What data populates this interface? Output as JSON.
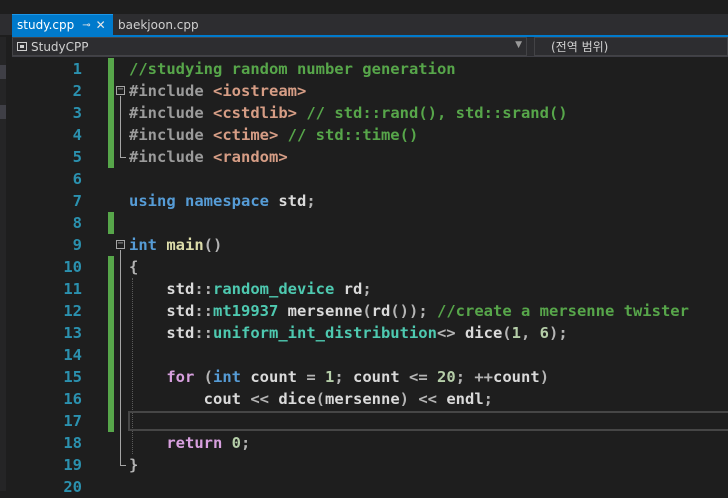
{
  "tabs": [
    {
      "label": "study.cpp",
      "active": true,
      "pin_icon": "pin-icon",
      "close_icon": "close-icon"
    },
    {
      "label": "baekjoon.cpp",
      "active": false
    }
  ],
  "navbar": {
    "project": "StudyCPP",
    "scope": "(전역 범위)"
  },
  "editor": {
    "current_line": 17,
    "lines": [
      {
        "n": "1",
        "tokens": [
          {
            "t": "//studying random number generation",
            "c": "t-com"
          }
        ]
      },
      {
        "n": "2",
        "tokens": [
          {
            "t": "#include ",
            "c": "t-pp"
          },
          {
            "t": "<iostream>",
            "c": "t-inc"
          }
        ]
      },
      {
        "n": "3",
        "tokens": [
          {
            "t": "#include ",
            "c": "t-pp"
          },
          {
            "t": "<cstdlib>",
            "c": "t-inc"
          },
          {
            "t": " // std::rand(), std::srand()",
            "c": "t-com"
          }
        ]
      },
      {
        "n": "4",
        "tokens": [
          {
            "t": "#include ",
            "c": "t-pp"
          },
          {
            "t": "<ctime>",
            "c": "t-inc"
          },
          {
            "t": " // std::time()",
            "c": "t-com"
          }
        ]
      },
      {
        "n": "5",
        "tokens": [
          {
            "t": "#include ",
            "c": "t-pp"
          },
          {
            "t": "<random>",
            "c": "t-inc"
          }
        ]
      },
      {
        "n": "6",
        "tokens": []
      },
      {
        "n": "7",
        "tokens": [
          {
            "t": "using ",
            "c": "t-kw"
          },
          {
            "t": "namespace ",
            "c": "t-kw"
          },
          {
            "t": "std",
            "c": "t-id"
          },
          {
            "t": ";",
            "c": "t-pl"
          }
        ]
      },
      {
        "n": "8",
        "tokens": []
      },
      {
        "n": "9",
        "tokens": [
          {
            "t": "int ",
            "c": "t-kw"
          },
          {
            "t": "main",
            "c": "t-fn"
          },
          {
            "t": "()",
            "c": "t-pl"
          }
        ]
      },
      {
        "n": "10",
        "tokens": [
          {
            "t": "{",
            "c": "t-pl"
          }
        ]
      },
      {
        "n": "11",
        "tokens": [
          {
            "t": "    std",
            "c": "t-id"
          },
          {
            "t": "::",
            "c": "t-pl"
          },
          {
            "t": "random_device ",
            "c": "t-ty"
          },
          {
            "t": "rd",
            "c": "t-id"
          },
          {
            "t": ";",
            "c": "t-pl"
          }
        ]
      },
      {
        "n": "12",
        "tokens": [
          {
            "t": "    std",
            "c": "t-id"
          },
          {
            "t": "::",
            "c": "t-pl"
          },
          {
            "t": "mt19937 ",
            "c": "t-ty"
          },
          {
            "t": "mersenne",
            "c": "t-id"
          },
          {
            "t": "(",
            "c": "t-pl"
          },
          {
            "t": "rd",
            "c": "t-id"
          },
          {
            "t": "()); ",
            "c": "t-pl"
          },
          {
            "t": "//create a mersenne twister",
            "c": "t-com"
          }
        ]
      },
      {
        "n": "13",
        "tokens": [
          {
            "t": "    std",
            "c": "t-id"
          },
          {
            "t": "::",
            "c": "t-pl"
          },
          {
            "t": "uniform_int_distribution",
            "c": "t-ty"
          },
          {
            "t": "<> ",
            "c": "t-pl"
          },
          {
            "t": "dice",
            "c": "t-id"
          },
          {
            "t": "(",
            "c": "t-pl"
          },
          {
            "t": "1",
            "c": "t-num"
          },
          {
            "t": ", ",
            "c": "t-pl"
          },
          {
            "t": "6",
            "c": "t-num"
          },
          {
            "t": ");",
            "c": "t-pl"
          }
        ]
      },
      {
        "n": "14",
        "tokens": []
      },
      {
        "n": "15",
        "tokens": [
          {
            "t": "    for ",
            "c": "t-ctl"
          },
          {
            "t": "(",
            "c": "t-pl"
          },
          {
            "t": "int ",
            "c": "t-kw"
          },
          {
            "t": "count ",
            "c": "t-id"
          },
          {
            "t": "= ",
            "c": "t-pl"
          },
          {
            "t": "1",
            "c": "t-num"
          },
          {
            "t": "; ",
            "c": "t-pl"
          },
          {
            "t": "count ",
            "c": "t-id"
          },
          {
            "t": "<= ",
            "c": "t-pl"
          },
          {
            "t": "20",
            "c": "t-num"
          },
          {
            "t": "; ++",
            "c": "t-pl"
          },
          {
            "t": "count",
            "c": "t-id"
          },
          {
            "t": ")",
            "c": "t-pl"
          }
        ]
      },
      {
        "n": "16",
        "tokens": [
          {
            "t": "        cout ",
            "c": "t-id"
          },
          {
            "t": "<< ",
            "c": "t-pl"
          },
          {
            "t": "dice",
            "c": "t-id"
          },
          {
            "t": "(",
            "c": "t-pl"
          },
          {
            "t": "mersenne",
            "c": "t-id"
          },
          {
            "t": ") << ",
            "c": "t-pl"
          },
          {
            "t": "endl",
            "c": "t-id"
          },
          {
            "t": ";",
            "c": "t-pl"
          }
        ]
      },
      {
        "n": "17",
        "tokens": []
      },
      {
        "n": "18",
        "tokens": [
          {
            "t": "    return ",
            "c": "t-ctl"
          },
          {
            "t": "0",
            "c": "t-num"
          },
          {
            "t": ";",
            "c": "t-pl"
          }
        ]
      },
      {
        "n": "19",
        "tokens": [
          {
            "t": "}",
            "c": "t-pl"
          }
        ]
      },
      {
        "n": "20",
        "tokens": []
      }
    ]
  }
}
